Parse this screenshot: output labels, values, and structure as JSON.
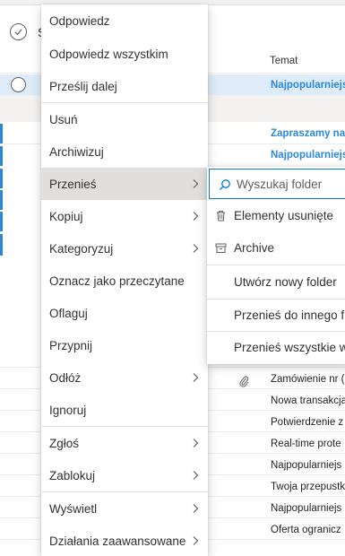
{
  "header": {
    "title_partial": "S"
  },
  "columns": {
    "subject": "Temat"
  },
  "rows": [
    {
      "subject": "Najpopularniejs",
      "unread": true
    },
    {
      "subject": "Zapraszamy na",
      "unread": true
    },
    {
      "subject": "Najpopularniejs",
      "unread": true
    },
    {
      "subject": "Zamówienie nr (",
      "unread": false
    },
    {
      "subject": "Nowa transakcja",
      "unread": false
    },
    {
      "subject": "Potwierdzenie z",
      "unread": false
    },
    {
      "subject": "Real-time prote",
      "unread": false
    },
    {
      "subject": "Najpopularniejs",
      "unread": false
    },
    {
      "subject": "Twoja przepustk",
      "unread": false
    },
    {
      "subject": "Najpopularniejs",
      "unread": false
    },
    {
      "subject": "Oferta ogranicz",
      "unread": false
    }
  ],
  "context_menu": {
    "items": [
      {
        "label": "Odpowiedz"
      },
      {
        "label": "Odpowiedz wszystkim"
      },
      {
        "label": "Prześlij dalej"
      },
      {
        "label": "Usuń"
      },
      {
        "label": "Archiwizuj"
      },
      {
        "label": "Przenieś",
        "submenu": true,
        "active": true
      },
      {
        "label": "Kopiuj",
        "submenu": true
      },
      {
        "label": "Kategoryzuj",
        "submenu": true
      },
      {
        "label": "Oznacz jako przeczytane"
      },
      {
        "label": "Oflaguj"
      },
      {
        "label": "Przypnij"
      },
      {
        "label": "Odłóż",
        "submenu": true
      },
      {
        "label": "Ignoruj"
      },
      {
        "label": "Zgłoś",
        "submenu": true
      },
      {
        "label": "Zablokuj",
        "submenu": true
      },
      {
        "label": "Wyświetl",
        "submenu": true
      },
      {
        "label": "Działania zaawansowane",
        "submenu": true
      }
    ]
  },
  "move_submenu": {
    "search_placeholder": "Wyszukaj folder",
    "items": [
      {
        "label": "Elementy usunięte",
        "icon": "trash-icon"
      },
      {
        "label": "Archive",
        "icon": "archive-icon"
      },
      {
        "label": "Utwórz nowy folder"
      },
      {
        "label": "Przenieś do innego f"
      },
      {
        "label": "Przenieś wszystkie w"
      }
    ]
  },
  "colors": {
    "accent": "#0078d4",
    "unread_subject": "#2b88d8",
    "selected_row": "#deecf9",
    "menu_hover": "#e1dfdd"
  }
}
